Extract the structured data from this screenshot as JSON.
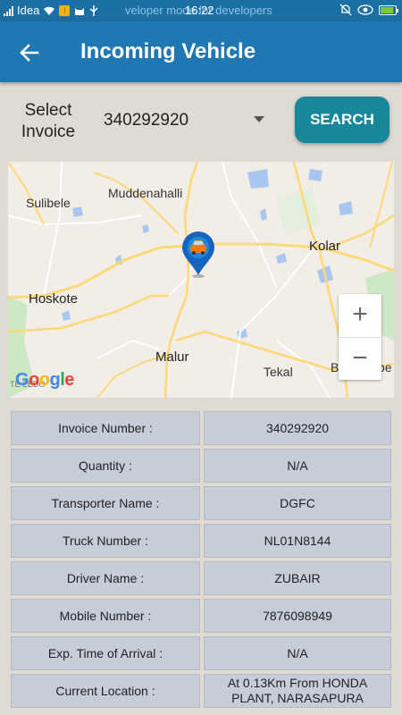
{
  "status_bar": {
    "carrier": "Idea",
    "developer_text": "veloper mode for developers",
    "time": "16:22"
  },
  "header": {
    "title": "Incoming Vehicle",
    "back_icon": "arrow-left-icon"
  },
  "invoice_selector": {
    "label": "Select Invoice",
    "selected_value": "340292920",
    "search_label": "SEARCH"
  },
  "map": {
    "places": {
      "sulibele": "Sulibele",
      "muddenahalli": "Muddenahalli",
      "kolar": "Kolar",
      "hoskote": "Hoskote",
      "malur": "Malur",
      "tekal": "Tekal",
      "bangarapet": "Bangarape",
      "small": "TE EEDO"
    },
    "zoom_in": "+",
    "zoom_out": "−",
    "logo": "Google",
    "marker_icon": "vehicle-location-marker-icon",
    "colors": {
      "marker": "#1565c0",
      "car": "#f57c00",
      "road_major": "#ffd966",
      "water": "#8ab4f8",
      "green": "#c8e6c9"
    }
  },
  "details": [
    {
      "label": "Invoice Number :",
      "value": "340292920"
    },
    {
      "label": "Quantity :",
      "value": "N/A"
    },
    {
      "label": "Transporter Name :",
      "value": "DGFC"
    },
    {
      "label": "Truck Number :",
      "value": "NL01N8144"
    },
    {
      "label": "Driver Name :",
      "value": "ZUBAIR"
    },
    {
      "label": "Mobile Number :",
      "value": "7876098949"
    },
    {
      "label": "Exp. Time of Arrival :",
      "value": "N/A"
    },
    {
      "label": "Current Location :",
      "value": "At 0.13Km From HONDA PLANT, NARASAPURA"
    }
  ],
  "colors": {
    "app_bar": "#1f78b1",
    "status_bar": "#1c6fa3",
    "search_button": "#17889a",
    "table_cell": "#c6ccd8",
    "page_bg": "#e0dbd2"
  }
}
